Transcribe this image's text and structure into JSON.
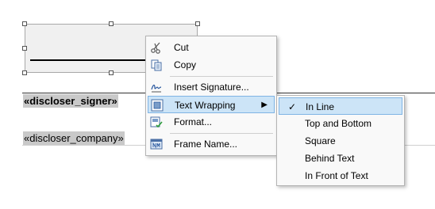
{
  "document": {
    "signer_field": "«discloser_signer»",
    "company_field": "«discloser_company»"
  },
  "context_menu": {
    "items": [
      {
        "label": "Cut",
        "icon": "scissors-icon"
      },
      {
        "label": "Copy",
        "icon": "copy-icon"
      },
      {
        "label": "Insert Signature...",
        "icon": "signature-icon"
      },
      {
        "label": "Text Wrapping",
        "icon": "text-wrapping-icon",
        "has_submenu": true
      },
      {
        "label": "Format...",
        "icon": "format-icon"
      },
      {
        "label": "Frame Name...",
        "icon": "frame-name-icon"
      }
    ],
    "submenu_arrow": "▶"
  },
  "text_wrapping_submenu": {
    "items": [
      {
        "label": "In Line",
        "checked": true
      },
      {
        "label": "Top and Bottom"
      },
      {
        "label": "Square"
      },
      {
        "label": "Behind Text"
      },
      {
        "label": "In Front of Text"
      }
    ],
    "check_glyph": "✓"
  },
  "colors": {
    "highlight": "#cce4f7",
    "highlight_border": "#7fb4e4",
    "field_shading": "#c9c9c9"
  }
}
